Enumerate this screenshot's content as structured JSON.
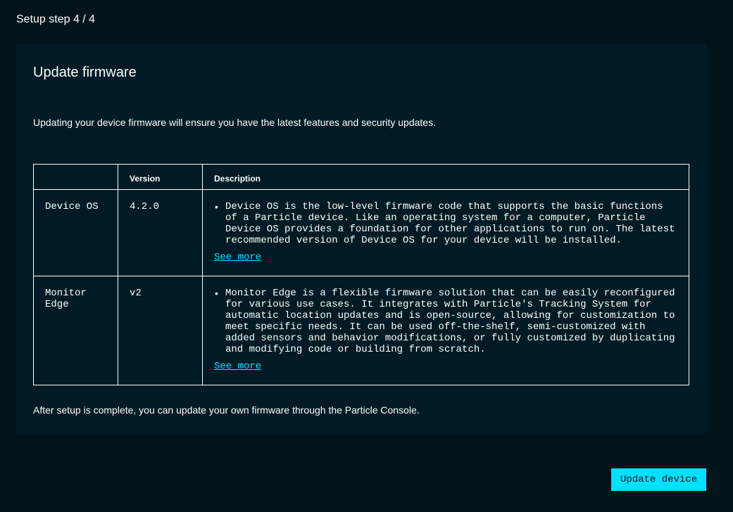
{
  "header": {
    "step_label": "Setup step 4 / 4"
  },
  "card": {
    "title": "Update firmware",
    "intro": "Updating your device firmware will ensure you have the latest features and security updates.",
    "table": {
      "columns": [
        "",
        "Version",
        "Description"
      ],
      "rows": [
        {
          "name": "Device OS",
          "version": "4.2.0",
          "description": "Device OS is the low-level firmware code that supports the basic functions of a Particle device. Like an operating system for a computer, Particle Device OS provides a foundation for other applications to run on. The latest recommended version of Device OS for your device will be installed.",
          "link_label": "See more"
        },
        {
          "name": "Monitor Edge",
          "version": "v2",
          "description": "Monitor Edge is a flexible firmware solution that can be easily reconfigured for various use cases. It integrates with Particle's Tracking System for automatic location updates and is open-source, allowing for customization to meet specific needs. It can be used off-the-shelf, semi-customized with added sensors and behavior modifications, or fully customized by duplicating and modifying code or building from scratch.",
          "link_label": "See more"
        }
      ]
    },
    "footer_note": "After setup is complete, you can update your own firmware through the Particle Console."
  },
  "actions": {
    "update_label": "Update device"
  },
  "colors": {
    "background": "#01141a",
    "card": "#001b25",
    "accent": "#00e1ff"
  }
}
